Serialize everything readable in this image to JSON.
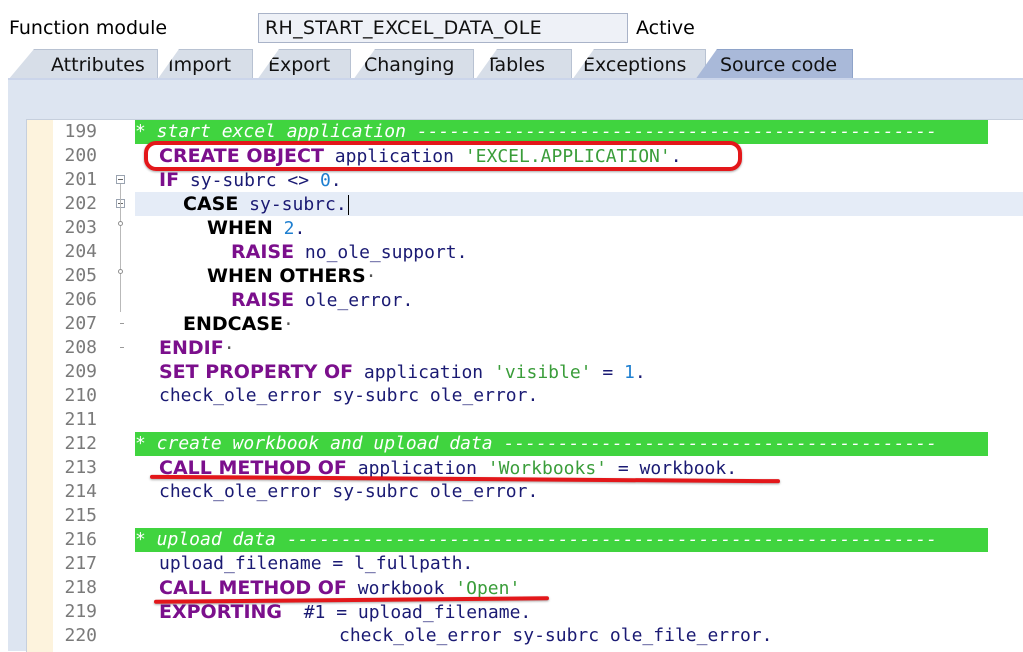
{
  "header": {
    "label": "Function module",
    "name": "RH_START_EXCEL_DATA_OLE",
    "status": "Active"
  },
  "tabs": [
    {
      "label": "Attributes",
      "active": false
    },
    {
      "label": "Import",
      "active": false
    },
    {
      "label": "Export",
      "active": false
    },
    {
      "label": "Changing",
      "active": false
    },
    {
      "label": "Tables",
      "active": false
    },
    {
      "label": "Exceptions",
      "active": false
    },
    {
      "label": "Source code",
      "active": true
    }
  ],
  "colors": {
    "comment_bg": "#40d43f",
    "keyword": "#7b0f8c",
    "string": "#3a9d3a",
    "number": "#1e7fd0",
    "annotation": "#e3171a",
    "active_tab": "#a9b9d9"
  },
  "editor": {
    "lines": [
      {
        "num": "199",
        "tokens": [
          {
            "t": "* start excel application ------------------------------------------------",
            "c": "comment"
          }
        ]
      },
      {
        "num": "200",
        "tokens": [
          {
            "t": "CREATE OBJECT",
            "c": "kw"
          },
          {
            "t": " application ",
            "c": "id"
          },
          {
            "t": "'EXCEL.APPLICATION'",
            "c": "str"
          },
          {
            "t": ".",
            "c": "id"
          }
        ]
      },
      {
        "num": "201",
        "tokens": [
          {
            "t": "IF",
            "c": "kw"
          },
          {
            "t": " sy-subrc <> ",
            "c": "id"
          },
          {
            "t": "0",
            "c": "num"
          },
          {
            "t": ".",
            "c": "id"
          }
        ]
      },
      {
        "num": "202",
        "tokens": [
          {
            "t": "CASE",
            "c": "kwb"
          },
          {
            "t": " sy-subrc.",
            "c": "id"
          }
        ]
      },
      {
        "num": "203",
        "tokens": [
          {
            "t": "WHEN",
            "c": "kwb"
          },
          {
            "t": " ",
            "c": "id"
          },
          {
            "t": "2",
            "c": "num"
          },
          {
            "t": ".",
            "c": "id"
          }
        ]
      },
      {
        "num": "204",
        "tokens": [
          {
            "t": "RAISE",
            "c": "kw"
          },
          {
            "t": " no_ole_support.",
            "c": "id"
          }
        ]
      },
      {
        "num": "205",
        "tokens": [
          {
            "t": "WHEN OTHERS",
            "c": "kwb"
          },
          {
            "t": "·",
            "c": "sdot"
          }
        ]
      },
      {
        "num": "206",
        "tokens": [
          {
            "t": "RAISE",
            "c": "kw"
          },
          {
            "t": " ole_error.",
            "c": "id"
          }
        ]
      },
      {
        "num": "207",
        "tokens": [
          {
            "t": "ENDCASE",
            "c": "kwb"
          },
          {
            "t": "·",
            "c": "sdot"
          }
        ]
      },
      {
        "num": "208",
        "tokens": [
          {
            "t": "ENDIF",
            "c": "kw"
          },
          {
            "t": "·",
            "c": "sdot"
          }
        ]
      },
      {
        "num": "209",
        "tokens": [
          {
            "t": "SET PROPERTY OF",
            "c": "kw"
          },
          {
            "t": " application ",
            "c": "id"
          },
          {
            "t": "'visible'",
            "c": "str"
          },
          {
            "t": " = ",
            "c": "id"
          },
          {
            "t": "1",
            "c": "num"
          },
          {
            "t": ".",
            "c": "id"
          }
        ]
      },
      {
        "num": "210",
        "tokens": [
          {
            "t": "check_ole_error sy-subrc ole_error.",
            "c": "id"
          }
        ]
      },
      {
        "num": "211",
        "tokens": []
      },
      {
        "num": "212",
        "tokens": [
          {
            "t": "* create workbook and upload data ----------------------------------------",
            "c": "comment"
          }
        ]
      },
      {
        "num": "213",
        "tokens": [
          {
            "t": "CALL METHOD OF",
            "c": "kw"
          },
          {
            "t": " application ",
            "c": "id"
          },
          {
            "t": "'Workbooks'",
            "c": "str"
          },
          {
            "t": " = workbook.",
            "c": "id"
          }
        ]
      },
      {
        "num": "214",
        "tokens": [
          {
            "t": "check_ole_error sy-subrc ole_error.",
            "c": "id"
          }
        ]
      },
      {
        "num": "215",
        "tokens": []
      },
      {
        "num": "216",
        "tokens": [
          {
            "t": "* upload data ------------------------------------------------------------",
            "c": "comment"
          }
        ]
      },
      {
        "num": "217",
        "tokens": [
          {
            "t": "upload_filename = l_fullpath.",
            "c": "id"
          }
        ]
      },
      {
        "num": "218",
        "tokens": [
          {
            "t": "CALL METHOD OF",
            "c": "kw"
          },
          {
            "t": " workbook ",
            "c": "id"
          },
          {
            "t": "'Open'",
            "c": "str"
          }
        ]
      },
      {
        "num": "219",
        "tokens": [
          {
            "t": "EXPORTING",
            "c": "kw"
          },
          {
            "t": "  #1 = upload_filename.",
            "c": "id"
          }
        ]
      },
      {
        "num": "220",
        "tokens": [
          {
            "t": "check_ole_error sy-subrc ole_file_error.",
            "c": "id"
          }
        ]
      }
    ]
  }
}
